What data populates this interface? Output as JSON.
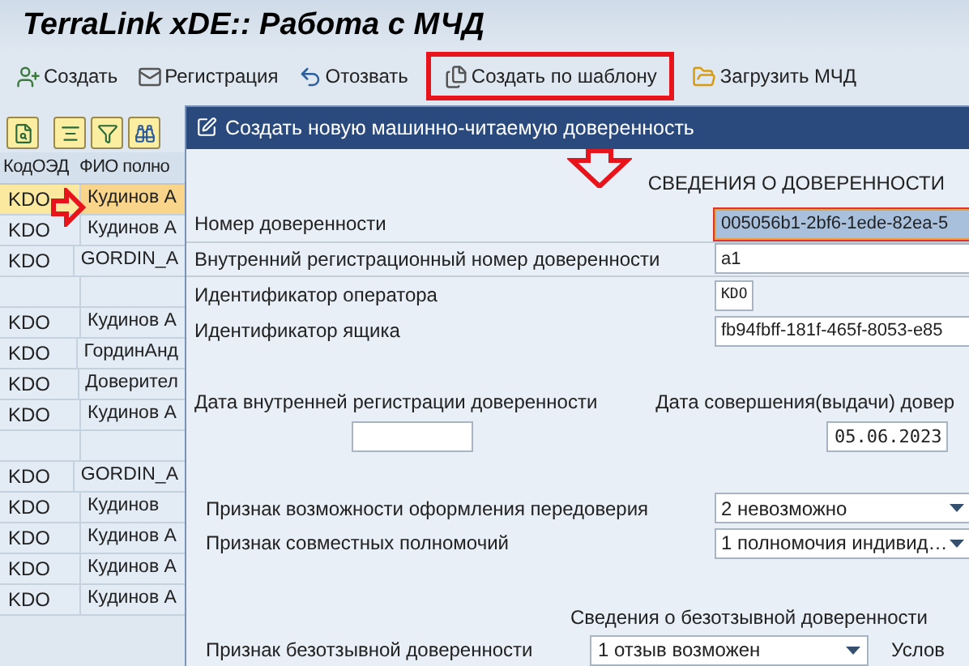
{
  "window": {
    "title": "TerraLink xDE:: Работа с МЧД"
  },
  "toolbar": [
    {
      "label": "Создать",
      "highlighted": false
    },
    {
      "label": "Регистрация",
      "highlighted": false
    },
    {
      "label": "Отозвать",
      "highlighted": false
    },
    {
      "label": "Создать по шаблону",
      "highlighted": true
    },
    {
      "label": "Загрузить МЧД",
      "highlighted": false
    }
  ],
  "table": {
    "columns": [
      "КодОЭД",
      "ФИО полно"
    ],
    "rows": [
      {
        "cells": [
          "KDO",
          "Кудинов А"
        ],
        "selected": true,
        "pointed": true
      },
      {
        "cells": [
          "KDO",
          "Кудинов А"
        ],
        "selected": false,
        "pointed": false
      },
      {
        "cells": [
          "KDO",
          "GORDIN_A"
        ],
        "selected": false,
        "pointed": false
      },
      {
        "cells": [],
        "selected": false,
        "pointed": false
      },
      {
        "cells": [
          "KDO",
          "Кудинов А"
        ],
        "selected": false,
        "pointed": false
      },
      {
        "cells": [
          "KDO",
          "ГординАнд"
        ],
        "selected": false,
        "pointed": false
      },
      {
        "cells": [
          "KDO",
          "Доверител"
        ],
        "selected": false,
        "pointed": false
      },
      {
        "cells": [
          "KDO",
          "Кудинов А"
        ],
        "selected": false,
        "pointed": false
      },
      {
        "cells": [],
        "selected": false,
        "pointed": false
      },
      {
        "cells": [
          "KDO",
          "GORDIN_A"
        ],
        "selected": false,
        "pointed": false
      },
      {
        "cells": [
          "KDO",
          "Кудинов"
        ],
        "selected": false,
        "pointed": false
      },
      {
        "cells": [
          "KDO",
          "Кудинов А"
        ],
        "selected": false,
        "pointed": false
      },
      {
        "cells": [
          "KDO",
          "Кудинов А"
        ],
        "selected": false,
        "pointed": false
      },
      {
        "cells": [
          "KDO",
          "Кудинов А"
        ],
        "selected": false,
        "pointed": false
      }
    ]
  },
  "dialog": {
    "title": "Создать новую машинно-читаемую доверенность",
    "section": "СВЕДЕНИЯ О ДОВЕРЕННОСТИ",
    "fields": [
      {
        "label": "Номер доверенности",
        "value": "005056b1-2bf6-1ede-82ea-5",
        "selected": true,
        "kind": "wide"
      },
      {
        "label": "Внутренний регистрационный номер доверенности",
        "value": "a1",
        "selected": false,
        "kind": "wide"
      },
      {
        "label": "Идентификатор оператора",
        "value": "KDO",
        "selected": false,
        "kind": "short"
      },
      {
        "label": "Идентификатор ящика",
        "value": "fb94fbff-181f-465f-8053-e85",
        "selected": false,
        "kind": "wide"
      }
    ],
    "dates": [
      {
        "label": "Дата внутренней регистрации доверенности"
      },
      {
        "label": "Дата совершения(выдачи) довер",
        "value": "05.06.2023"
      }
    ],
    "selects": [
      {
        "label": "Признак возможности оформления передоверия",
        "value": "2 невозможно"
      },
      {
        "label": "Признак совместных полномочий",
        "value": "1 полномочия индивид…"
      }
    ],
    "subsection": "Сведения о безотзывной доверенности",
    "irrevocable": {
      "label": "Признак безотзывной доверенности",
      "value": "1 отзыв возможен",
      "next_label": "Услов"
    }
  }
}
